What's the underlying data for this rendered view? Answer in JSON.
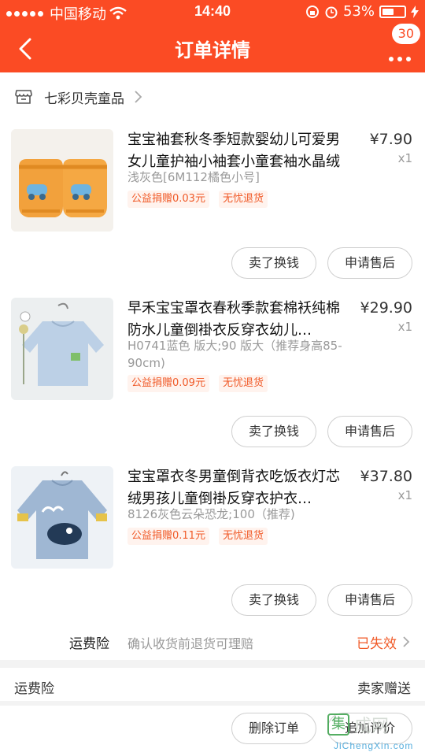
{
  "status_bar": {
    "carrier": "中国移动",
    "time": "14:40",
    "battery": "53%",
    "battery_level": 0.53
  },
  "nav": {
    "title": "订单详情",
    "message_count": "30"
  },
  "store": {
    "name": "七彩贝壳童品"
  },
  "items": [
    {
      "title": "宝宝袖套秋冬季短款婴幼儿可爱男女儿童护袖小袖套小童套袖水晶绒",
      "price": "¥7.90",
      "qty": "x1",
      "spec": "浅灰色[6M112橘色小号]",
      "tags": [
        "公益捐赠0.03元",
        "无忧退货"
      ],
      "buttons": [
        "卖了换钱",
        "申请售后"
      ]
    },
    {
      "title": "早禾宝宝罩衣春秋季款套棉袄纯棉防水儿童倒褂衣反穿衣幼儿…",
      "price": "¥29.90",
      "qty": "x1",
      "spec": "H0741蓝色  版大;90 版大（推荐身高85-90cm)",
      "tags": [
        "公益捐赠0.09元",
        "无忧退货"
      ],
      "buttons": [
        "卖了换钱",
        "申请售后"
      ]
    },
    {
      "title": "宝宝罩衣冬男童倒背衣吃饭衣灯芯绒男孩儿童倒褂反穿衣护衣…",
      "price": "¥37.80",
      "qty": "x1",
      "spec": "8126灰色云朵恐龙;100（推荐)",
      "tags": [
        "公益捐赠0.11元",
        "无忧退货"
      ],
      "buttons": [
        "卖了换钱",
        "申请售后"
      ]
    }
  ],
  "insurance": {
    "label": "运费险",
    "desc": "确认收货前退货可理赔",
    "status": "已失效"
  },
  "shipping": {
    "label": "运费险",
    "value": "卖家赠送"
  },
  "bottom_buttons": {
    "delete": "删除订单",
    "review": "追加评价"
  },
  "watermark": {
    "logo_char": "集",
    "text": "成网",
    "url": "JiChengXin.com"
  },
  "colors": {
    "brand": "#fb4b24",
    "accent": "#f05a28"
  }
}
